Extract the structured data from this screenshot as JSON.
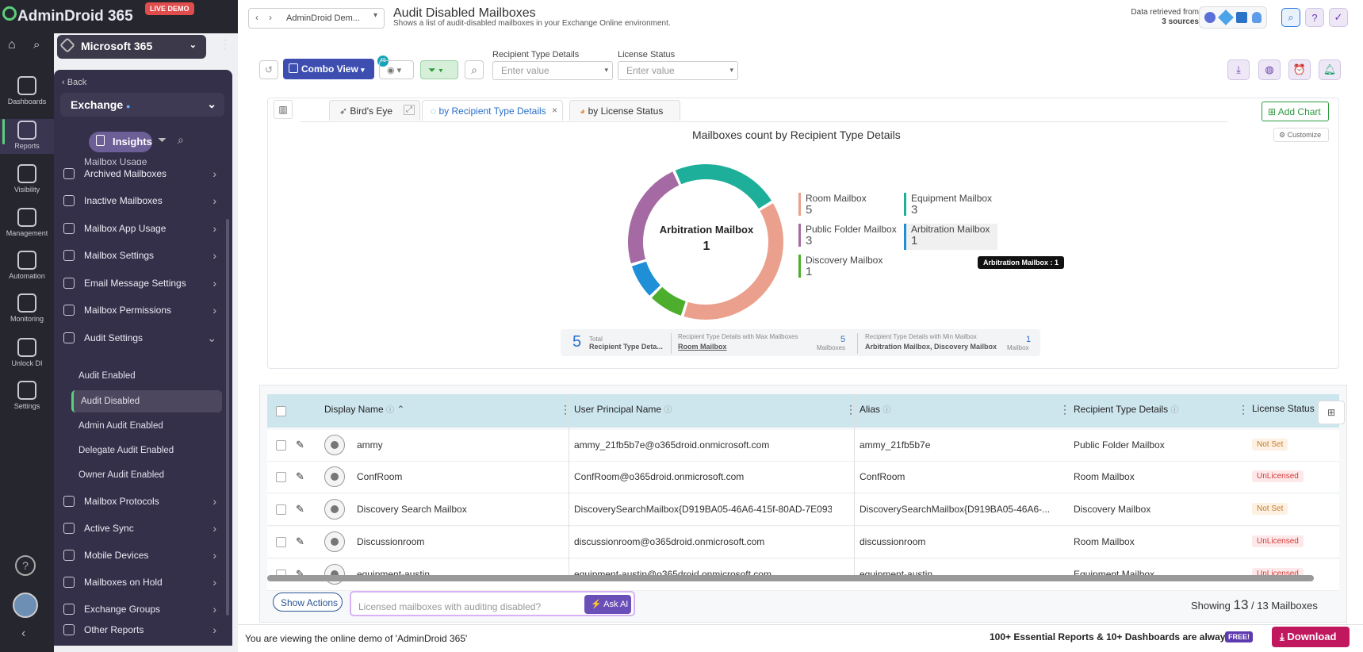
{
  "app": {
    "brand": "AdminDroid 365",
    "live_demo": "LIVE DEMO",
    "tenant": "Microsoft 365"
  },
  "rail": [
    {
      "label": "Dashboards",
      "icon": "dashboards-icon"
    },
    {
      "label": "Reports",
      "icon": "reports-icon"
    },
    {
      "label": "Visibility",
      "icon": "visibility-icon"
    },
    {
      "label": "Management",
      "icon": "management-icon"
    },
    {
      "label": "Automation",
      "icon": "automation-icon"
    },
    {
      "label": "Monitoring",
      "icon": "monitoring-icon"
    },
    {
      "label": "Unlock DI",
      "icon": "unlock-icon"
    },
    {
      "label": "Settings",
      "icon": "settings-icon"
    }
  ],
  "nav": {
    "back": "Back",
    "section": "Exchange",
    "insights": "Insights",
    "top_partial": "Mailbox Usage",
    "items": [
      "Archived Mailboxes",
      "Inactive Mailboxes",
      "Mailbox App Usage",
      "Mailbox Settings",
      "Email Message Settings",
      "Mailbox Permissions",
      "Audit Settings"
    ],
    "sub": [
      "Audit Enabled",
      "Audit Disabled",
      "Admin Audit Enabled",
      "Delegate Audit Enabled",
      "Owner Audit Enabled"
    ],
    "items2": [
      "Mailbox Protocols",
      "Active Sync",
      "Mobile Devices",
      "Mailboxes on Hold",
      "Exchange Groups",
      "Other Reports"
    ]
  },
  "header": {
    "breadcrumb": "AdminDroid Dem...",
    "title": "Audit Disabled Mailboxes",
    "subtitle": "Shows a list of audit-disabled mailboxes in your Exchange Online environment.",
    "retrieved_from": "Data retrieved from",
    "sources": "3 sources"
  },
  "toolbar": {
    "combo_view": "Combo View",
    "badge": "45",
    "filter1_label": "Recipient Type Details",
    "filter1_placeholder": "Enter value",
    "filter2_label": "License Status",
    "filter2_placeholder": "Enter value"
  },
  "chart_tabs": [
    "Bird's Eye",
    "by Recipient Type Details",
    "by License Status"
  ],
  "add_chart": "Add Chart",
  "customize": "Customize",
  "chart_data": {
    "type": "pie",
    "title": "Mailboxes count by Recipient Type Details",
    "center_label": "Arbitration Mailbox",
    "center_value": "1",
    "tooltip": "Arbitration Mailbox : 1",
    "series": [
      {
        "name": "Room Mailbox",
        "value": 5,
        "color": "#eaa08c"
      },
      {
        "name": "Equipment Mailbox",
        "value": 3,
        "color": "#1eaf9a"
      },
      {
        "name": "Public Folder Mailbox",
        "value": 3,
        "color": "#a56aa3"
      },
      {
        "name": "Arbitration Mailbox",
        "value": 1,
        "color": "#1f8fd8"
      },
      {
        "name": "Discovery Mailbox",
        "value": 1,
        "color": "#4cae2c"
      }
    ],
    "legend": [
      {
        "name": "Room Mailbox",
        "value": "5"
      },
      {
        "name": "Equipment Mailbox",
        "value": "3"
      },
      {
        "name": "Public Folder Mailbox",
        "value": "3"
      },
      {
        "name": "Arbitration Mailbox",
        "value": "1"
      },
      {
        "name": "Discovery Mailbox",
        "value": "1"
      }
    ]
  },
  "summary": {
    "total": "5",
    "total_label": "Total",
    "total_sub": "Recipient Type Deta...",
    "max_label": "Recipient Type Details with Max Mailboxes",
    "max_value": "Room Mailbox",
    "max_count": "5",
    "max_unit": "Mailboxes",
    "min_label": "Recipient Type Details with Min Mailbox",
    "min_value": "Arbitration Mailbox, Discovery Mailbox",
    "min_count": "1",
    "min_unit": "Mailbox"
  },
  "table": {
    "columns": [
      "Display Name",
      "User Principal Name",
      "Alias",
      "Recipient Type Details",
      "License Status"
    ],
    "rows": [
      {
        "name": "ammy",
        "upn": "ammy_21fb5b7e@o365droid.onmicrosoft.com",
        "alias": "ammy_21fb5b7e",
        "type": "Public Folder Mailbox",
        "license": "Not Set"
      },
      {
        "name": "ConfRoom",
        "upn": "ConfRoom@o365droid.onmicrosoft.com",
        "alias": "ConfRoom",
        "type": "Room Mailbox",
        "license": "UnLicensed"
      },
      {
        "name": "Discovery Search Mailbox",
        "upn": "DiscoverySearchMailbox{D919BA05-46A6-415f-80AD-7E093...",
        "alias": "DiscoverySearchMailbox{D919BA05-46A6-...",
        "type": "Discovery Mailbox",
        "license": "Not Set"
      },
      {
        "name": "Discussionroom",
        "upn": "discussionroom@o365droid.onmicrosoft.com",
        "alias": "discussionroom",
        "type": "Room Mailbox",
        "license": "UnLicensed"
      },
      {
        "name": "equipment-austin",
        "upn": "equipment-austin@o365droid.onmicrosoft.com",
        "alias": "equipment-austin",
        "type": "Equipment Mailbox",
        "license": "UnLicensed"
      }
    ]
  },
  "footer": {
    "show_actions": "Show Actions",
    "ask_placeholder": "Licensed mailboxes with auditing disabled?",
    "ask_ai": "Ask AI",
    "showing": "Showing",
    "count": "13",
    "total": "/ 13 Mailboxes"
  },
  "bottom": {
    "viewing": "You are viewing the online demo of 'AdminDroid 365'",
    "promo": "100+ Essential Reports & 10+ Dashboards are always",
    "free": "FREE!",
    "download": "Download"
  }
}
